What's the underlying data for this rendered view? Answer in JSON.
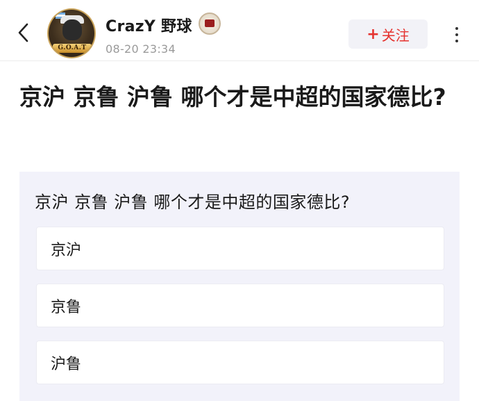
{
  "header": {
    "back_icon": "chevron-left-icon",
    "username": "CrazY 野球",
    "avatar_banner": "G.O.A.T",
    "timestamp": "08-20 23:34",
    "follow_label": "关注",
    "follow_plus": "+",
    "more_icon": "more-vertical-icon",
    "accent_color": "#e5332f"
  },
  "post": {
    "title": "京沪 京鲁 沪鲁 哪个才是中超的国家德比?"
  },
  "poll": {
    "question": "京沪 京鲁 沪鲁 哪个才是中超的国家德比?",
    "options": [
      {
        "label": "京沪"
      },
      {
        "label": "京鲁"
      },
      {
        "label": "沪鲁"
      }
    ]
  }
}
